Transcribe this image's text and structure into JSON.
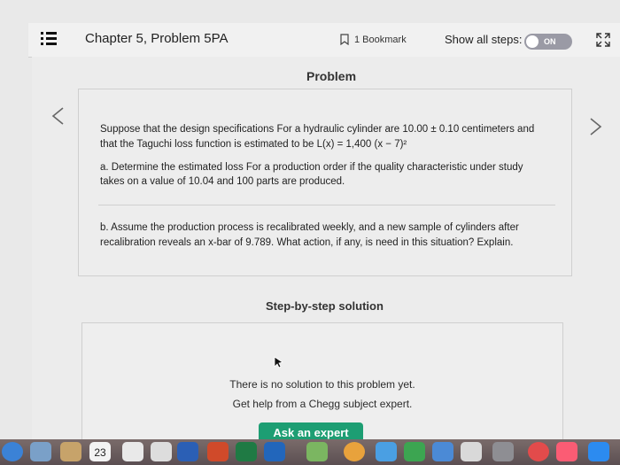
{
  "header": {
    "title": "Chapter 5, Problem 5PA",
    "bookmark_label": "1 Bookmark",
    "show_steps_label": "Show all steps:",
    "toggle_label": "ON"
  },
  "problem": {
    "heading": "Problem",
    "intro_line1": "Suppose that the design specifications For a hydraulic cylinder are 10.00 ± 0.10 centimeters and",
    "intro_line2": "that the Taguchi loss function is estimated to be L(x) = 1,400 (x − 7)²",
    "part_a_line1": "a. Determine the estimated loss For a production order if the quality characteristic under study",
    "part_a_line2": "takes on a value of 10.04 and 100 parts are produced.",
    "part_b_line1": "b. Assume the production process is recalibrated weekly, and a new sample of cylinders after",
    "part_b_line2": "recalibration reveals an x-bar of 9.789. What action, if any, is need in this situation? Explain."
  },
  "solution": {
    "heading": "Step-by-step solution",
    "no_solution": "There is no solution to this problem yet.",
    "help_text": "Get help from a Chegg subject expert.",
    "ask_button": "Ask an expert"
  },
  "dock": {
    "calendar_day": "23",
    "items": [
      "finder-icon",
      "preview-icon",
      "calendar-icon",
      "notes-icon",
      "word-icon",
      "powerpoint-icon",
      "excel-icon",
      "outlook-icon",
      "maps-icon",
      "photos-icon",
      "safari-icon",
      "chrome-icon",
      "messages-icon",
      "facetime-icon",
      "pages-icon",
      "keynote-icon",
      "system-preferences-icon",
      "news-icon",
      "music-icon",
      "appstore-icon"
    ]
  },
  "colors": {
    "accent_green": "#1d9e73",
    "toggle_bg": "#9a9aa5"
  }
}
